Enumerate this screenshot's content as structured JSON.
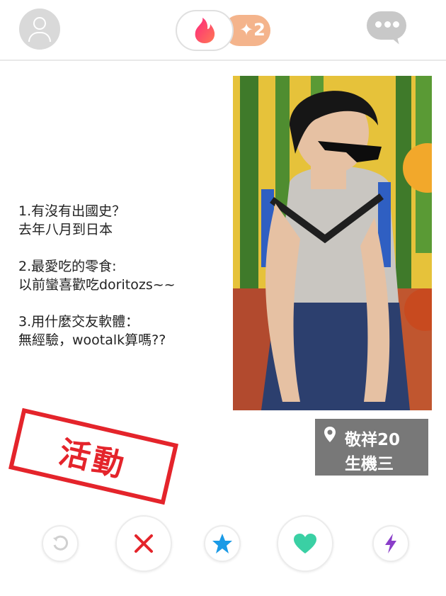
{
  "header": {
    "profile_icon": "person-icon",
    "logo_icon": "flame-icon",
    "boost_label": "✦2",
    "messages_icon": "chat-bubble-icon"
  },
  "profile": {
    "bio": [
      {
        "q": "1.有沒有出國史？",
        "a": "去年八月到日本"
      },
      {
        "q": "2.最愛吃的零食:",
        "a": "以前蠻喜歡吃doritozs~~"
      },
      {
        "q": "3.用什麼交友軟體：",
        "a": "無經驗，wootalk算嗎??"
      }
    ],
    "name_age": "敬祥20",
    "department": "生機三",
    "location_icon": "location-pin-icon",
    "stamp_text": "活動"
  },
  "actions": [
    {
      "name": "rewind-button",
      "icon": "rewind-icon"
    },
    {
      "name": "nope-button",
      "icon": "x-icon"
    },
    {
      "name": "super-like-button",
      "icon": "star-icon"
    },
    {
      "name": "like-button",
      "icon": "heart-icon"
    },
    {
      "name": "boost-button",
      "icon": "lightning-icon"
    }
  ],
  "colors": {
    "brand_gradient": [
      "#fd267d",
      "#ff7854"
    ],
    "nope": "#e4242b",
    "super_like": "#1a9ae6",
    "like": "#3ad0a4",
    "boost": "#8a3ec9",
    "stamp": "#e4242b",
    "info_box": "#787878"
  }
}
